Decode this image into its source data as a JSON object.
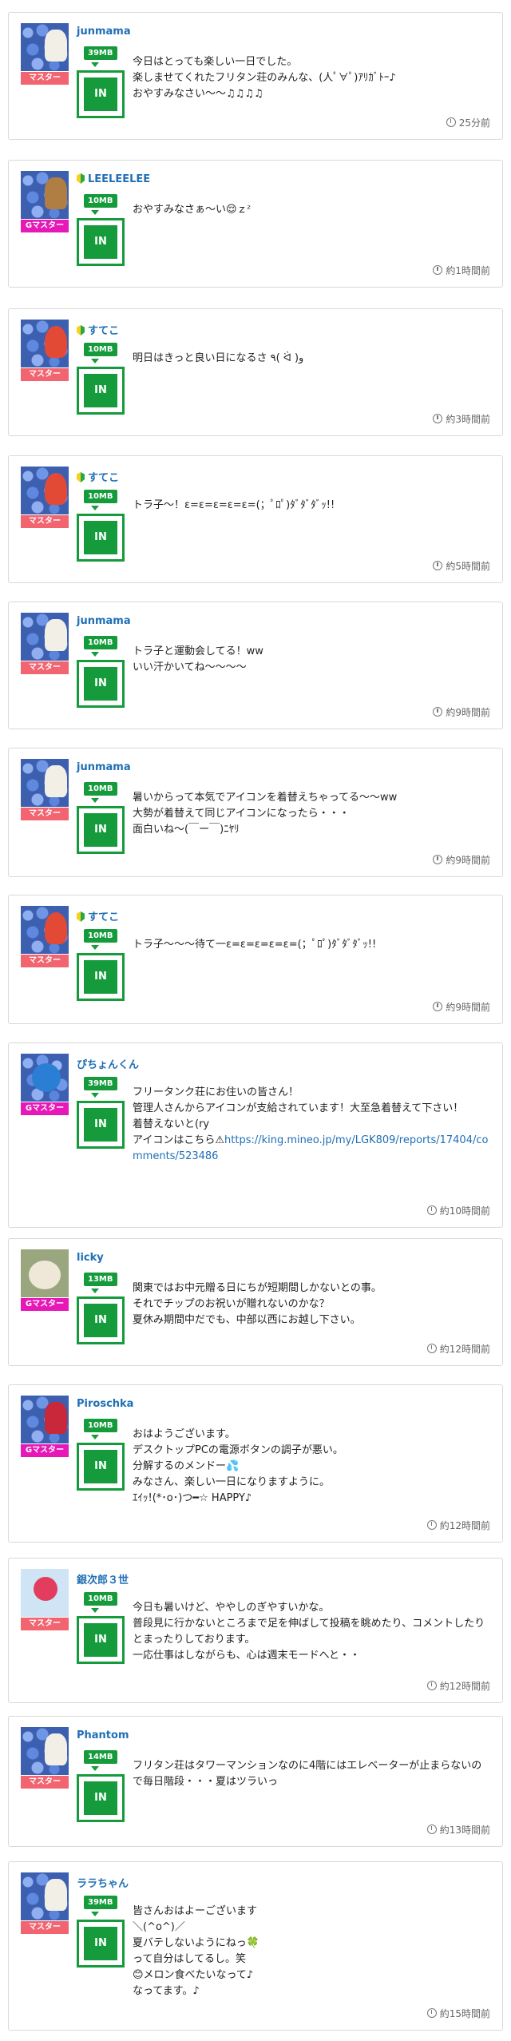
{
  "posts": [
    {
      "username": "junmama",
      "beginner": false,
      "rank": "マスター",
      "rank_type": "master",
      "data": "39MB",
      "in": "IN",
      "text": "今日はとっても楽しい一日でした。\n楽しませてくれたフリタン荘のみんな、(人ﾟ∀ﾟ)ｱﾘｶﾞﾄｰ♪\nおやすみなさい〜〜♫♫♫♫",
      "time": "25分前"
    },
    {
      "username": "LEELEELEE",
      "beginner": true,
      "rank": "Gマスター",
      "rank_type": "gmaster",
      "data": "10MB",
      "in": "IN",
      "text": "おやすみなさぁ〜い😌ｚᶻ",
      "time": "約1時間前"
    },
    {
      "username": "すてこ",
      "beginner": true,
      "rank": "マスター",
      "rank_type": "master",
      "data": "10MB",
      "in": "IN",
      "text": "明日はきっと良い日になるさ ٩( ᐛ )و",
      "time": "約3時間前"
    },
    {
      "username": "すてこ",
      "beginner": true,
      "rank": "マスター",
      "rank_type": "master",
      "data": "10MB",
      "in": "IN",
      "text": "トラ子〜！ε=ε=ε=ε=ε=(；ﾟﾛﾟ)ﾀﾞﾀﾞﾀﾞｯ!!",
      "time": "約5時間前"
    },
    {
      "username": "junmama",
      "beginner": false,
      "rank": "マスター",
      "rank_type": "master",
      "data": "10MB",
      "in": "IN",
      "text": "トラ子と運動会してる！ww\nいい汗かいてね〜〜〜〜",
      "time": "約9時間前"
    },
    {
      "username": "junmama",
      "beginner": false,
      "rank": "マスター",
      "rank_type": "master",
      "data": "10MB",
      "in": "IN",
      "text": "暑いからって本気でアイコンを着替えちゃってる〜〜ww\n大勢が着替えて同じアイコンになったら・・・\n面白いね〜(￣ー￣)ﾆﾔﾘ",
      "time": "約9時間前"
    },
    {
      "username": "すてこ",
      "beginner": true,
      "rank": "マスター",
      "rank_type": "master",
      "data": "10MB",
      "in": "IN",
      "text": "トラ子〜〜〜待て一ε=ε=ε=ε=ε=(；ﾟﾛﾟ)ﾀﾞﾀﾞﾀﾞｯ!!",
      "time": "約9時間前"
    },
    {
      "username": "ぴちょんくん",
      "beginner": false,
      "rank": "Gマスター",
      "rank_type": "gmaster",
      "data": "39MB",
      "in": "IN",
      "text": "フリータンク荘にお住いの皆さん！\n管理人さんからアイコンが支給されています！大至急着替えて下さい！\n着替えないと(ry\nアイコンはこちら⚠︎",
      "link": "https://king.mineo.jp/my/LGK809/reports/17404/comments/523486",
      "time": "約10時間前"
    },
    {
      "username": "licky",
      "beginner": false,
      "rank": "Gマスター",
      "rank_type": "gmaster",
      "data": "13MB",
      "in": "IN",
      "text": "関東ではお中元贈る日にちが短期間しかないとの事。\nそれでチップのお祝いが贈れないのかな？\n夏休み期間中だでも、中部以西にお越し下さい。",
      "time": "約12時間前"
    },
    {
      "username": "Piroschka",
      "beginner": false,
      "rank": "Gマスター",
      "rank_type": "gmaster",
      "data": "10MB",
      "in": "IN",
      "text": "おはようございます。\nデスクトップPCの電源ボタンの調子が悪い。\n分解するのメンドー💦\nみなさん、楽しい一日になりますように。\nｴｲｯ!(*･o･)つ━☆ HAPPY♪",
      "time": "約12時間前"
    },
    {
      "username": "銀次郎３世",
      "beginner": false,
      "rank": "マスター",
      "rank_type": "master",
      "data": "10MB",
      "in": "IN",
      "text": "今日も暑いけど、ややしのぎやすいかな。\n普段見に行かないところまで足を伸ばして投稿を眺めたり、コメントしたりとまったりしております。\n一応仕事はしながらも、心は週末モードへと・・",
      "time": "約12時間前"
    },
    {
      "username": "Phantom",
      "beginner": false,
      "rank": "マスター",
      "rank_type": "master",
      "data": "14MB",
      "in": "IN",
      "text": "フリタン荘はタワーマンションなのに4階にはエレベーターが止まらないので毎日階段・・・夏はツラいっ",
      "time": "約13時間前"
    },
    {
      "username": "ララちゃん",
      "beginner": false,
      "rank": "マスター",
      "rank_type": "master",
      "data": "39MB",
      "in": "IN",
      "text": "皆さんおはよーございます\n＼(^o^)／\n夏バテしないようにねっ🍀\nって自分はしてるし。笑\n😊メロン食べたいなって♪\nなってます。♪",
      "time": "約15時間前"
    }
  ],
  "colors": {
    "link": "#1f6fb5",
    "green": "#159b3c",
    "master": "#f26470",
    "gmaster": "#e619b8"
  }
}
